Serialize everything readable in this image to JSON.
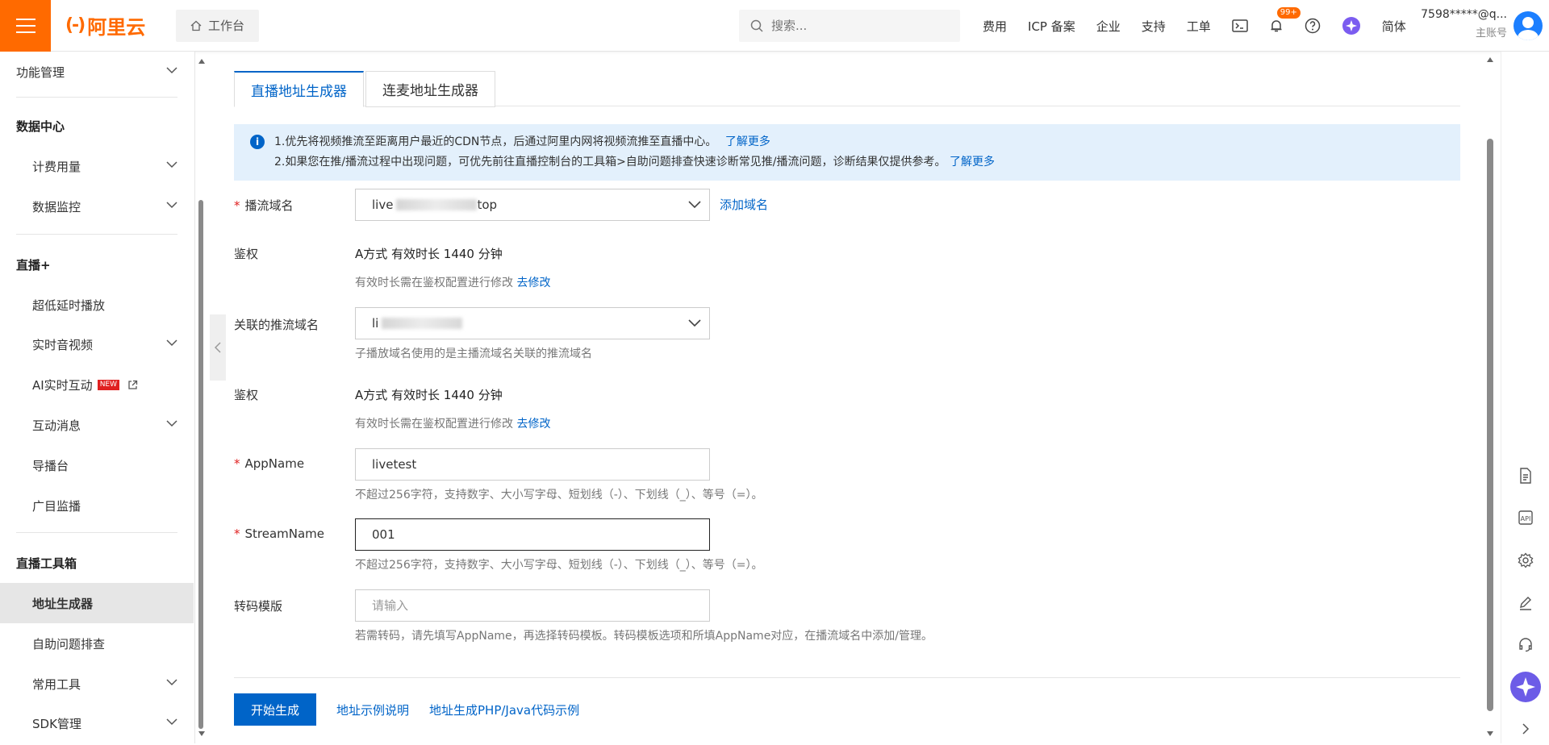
{
  "header": {
    "logo_text": "阿里云",
    "logo_mark": "(-)",
    "workbench": "工作台",
    "search_placeholder": "搜索...",
    "nav": [
      "费用",
      "ICP 备案",
      "企业",
      "支持",
      "工单"
    ],
    "notification_count": "99+",
    "language": "简体",
    "account_name": "7598*****@q...",
    "account_type": "主账号"
  },
  "sidebar": {
    "items": [
      {
        "label": "功能管理"
      },
      {
        "group": "数据中心"
      },
      {
        "label": "计费用量"
      },
      {
        "label": "数据监控"
      },
      {
        "group": "直播+"
      },
      {
        "label": "超低延时播放"
      },
      {
        "label": "实时音视频"
      },
      {
        "label": "AI实时互动",
        "badge": "NEW"
      },
      {
        "label": "互动消息"
      },
      {
        "label": "导播台"
      },
      {
        "label": "广目监播"
      },
      {
        "group": "直播工具箱"
      },
      {
        "label": "地址生成器"
      },
      {
        "label": "自助问题排查"
      },
      {
        "label": "常用工具"
      },
      {
        "label": "SDK管理"
      }
    ]
  },
  "tabs": [
    "直播地址生成器",
    "连麦地址生成器"
  ],
  "notice": {
    "line1": "1.优先将视频推流至距离用户最近的CDN节点，后通过阿里内网将视频流推至直播中心。",
    "line1_link": "了解更多",
    "line2": "2.如果您在推/播流过程中出现问题，可优先前往直播控制台的工具箱>自助问题排查快速诊断常见推/播流问题，诊断结果仅提供参考。",
    "line2_link": "了解更多"
  },
  "form": {
    "play_domain_label": "播流域名",
    "play_domain_value_prefix": "live",
    "play_domain_value_suffix": "top",
    "add_domain": "添加域名",
    "auth_label": "鉴权",
    "auth_value": "A方式 有效时长 1440 分钟",
    "auth_hint": "有效时长需在鉴权配置进行修改",
    "auth_link": "去修改",
    "push_domain_label": "关联的推流域名",
    "push_domain_value_prefix": "li",
    "push_domain_hint": "子播放域名使用的是主播流域名关联的推流域名",
    "auth2_label": "鉴权",
    "auth2_value": "A方式 有效时长 1440 分钟",
    "auth2_hint": "有效时长需在鉴权配置进行修改",
    "auth2_link": "去修改",
    "appname_label": "AppName",
    "appname_value": "livetest",
    "appname_hint": "不超过256字符，支持数字、大小写字母、短划线（-）、下划线（_）、等号（=）。",
    "streamname_label": "StreamName",
    "streamname_value": "001",
    "streamname_hint": "不超过256字符，支持数字、大小写字母、短划线（-）、下划线（_）、等号（=）。",
    "template_label": "转码模版",
    "template_placeholder": "请输入",
    "template_hint": "若需转码，请先填写AppName，再选择转码模板。转码模板选项和所填AppName对应，在播流域名中添加/管理。"
  },
  "actions": {
    "generate": "开始生成",
    "example": "地址示例说明",
    "code_example": "地址生成PHP/Java代码示例"
  },
  "colors": {
    "brand": "#ff6a00",
    "primary": "#0064c8",
    "notice_bg": "#e3f0fc",
    "required": "#e02020"
  }
}
